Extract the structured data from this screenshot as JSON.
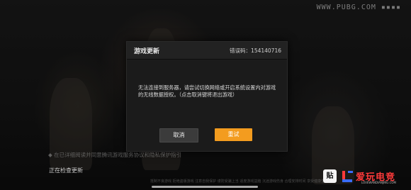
{
  "top_right_text": "WWW.PUBG.COM  ▪▪▪▪",
  "dialog": {
    "title": "游戏更新",
    "error_code": "错误码：154140716",
    "message": "无法连接到服务器，请尝试切换网络或开启系统设置内对游戏的无线数据授权。（点击取消键将退出游戏）",
    "cancel_label": "取消",
    "retry_label": "重试"
  },
  "bottom_note": "◆ 在已详细阅读并同意腾讯游戏服务协议和隐私保护指引",
  "status_text": "正在检查更新",
  "footer_text": "抵制不良游戏 拒绝盗版游戏 注意自我保护 谨防受骗上当 适度游戏益脑 沉迷游戏伤身 合理安排时间 享受健康生活",
  "paste_label": "贴",
  "watermark": {
    "text": "爱玩电竞",
    "sub": "LOVEWANDIANJING.COM"
  },
  "colors": {
    "retry_button": "#f39c1f",
    "watermark": "#ff3a3a"
  }
}
